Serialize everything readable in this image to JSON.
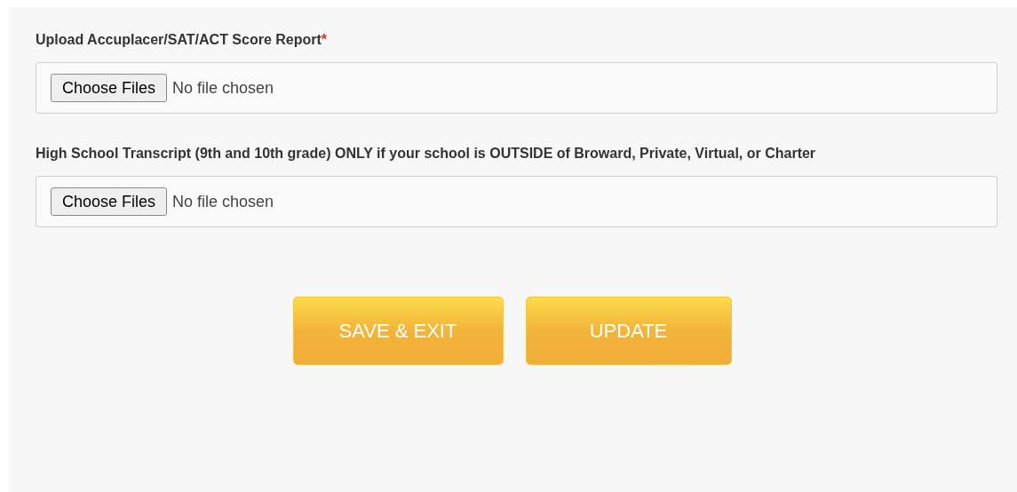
{
  "uploads": [
    {
      "label": "Upload Accuplacer/SAT/ACT Score Report",
      "required_mark": "*",
      "button": "Choose Files",
      "status": "No file chosen"
    },
    {
      "label": "High School Transcript (9th and 10th grade) ONLY if your school is OUTSIDE of Broward, Private, Virtual, or Charter",
      "button": "Choose Files",
      "status": "No file chosen"
    }
  ],
  "buttons": [
    "SAVE & EXIT",
    "UPDATE"
  ]
}
